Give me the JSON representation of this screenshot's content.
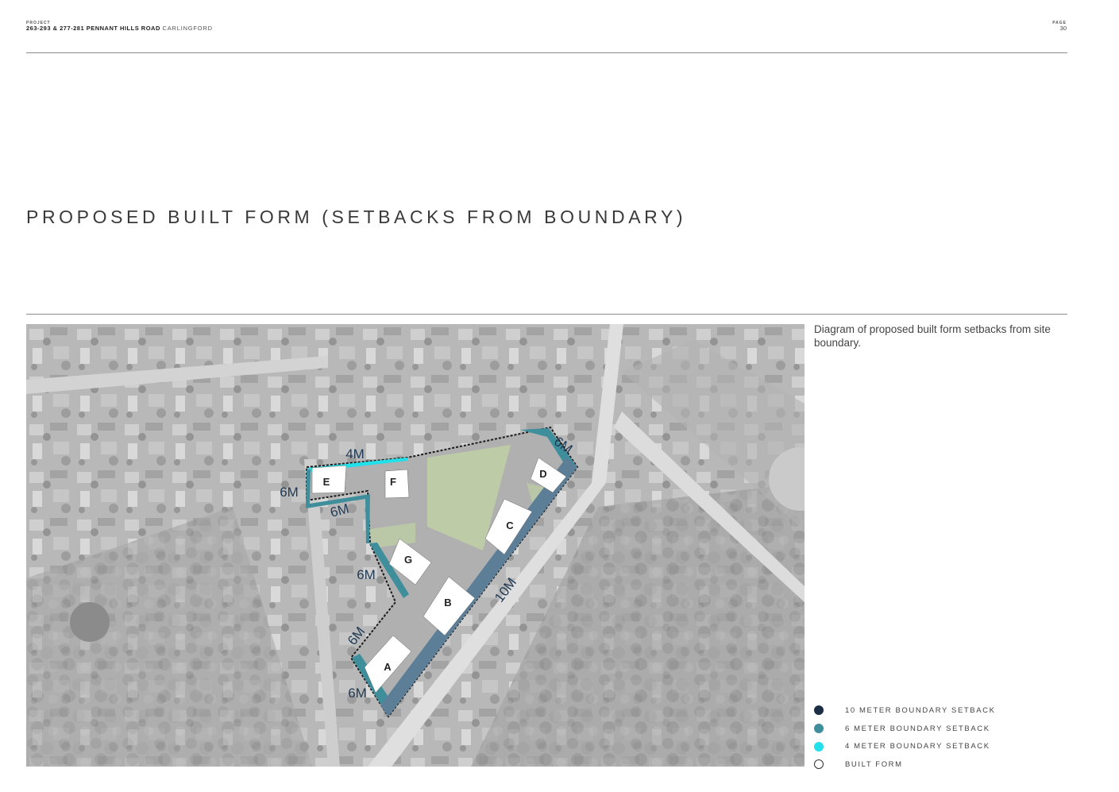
{
  "header": {
    "project_label": "PROJECT",
    "project_bold": "263-293 & 277-281 PENNANT HILLS ROAD",
    "project_location": "CARLINGFORD",
    "page_label": "PAGE",
    "page_number": "30"
  },
  "title": "PROPOSED BUILT FORM (SETBACKS FROM BOUNDARY)",
  "caption": "Diagram of proposed built form setbacks from site boundary.",
  "map": {
    "buildings": [
      "A",
      "B",
      "C",
      "D",
      "E",
      "F",
      "G"
    ],
    "setback_labels": [
      "4M",
      "6M",
      "6M",
      "6M",
      "6M",
      "6M",
      "6M",
      "10M"
    ]
  },
  "legend": [
    {
      "label": "10 METER BOUNDARY SETBACK",
      "color": "#1b2e46"
    },
    {
      "label": "6 METER BOUNDARY SETBACK",
      "color": "#3f8e9c"
    },
    {
      "label": "4 METER BOUNDARY SETBACK",
      "color": "#22e0ea"
    },
    {
      "label": "BUILT FORM",
      "color": "#ffffff"
    }
  ]
}
